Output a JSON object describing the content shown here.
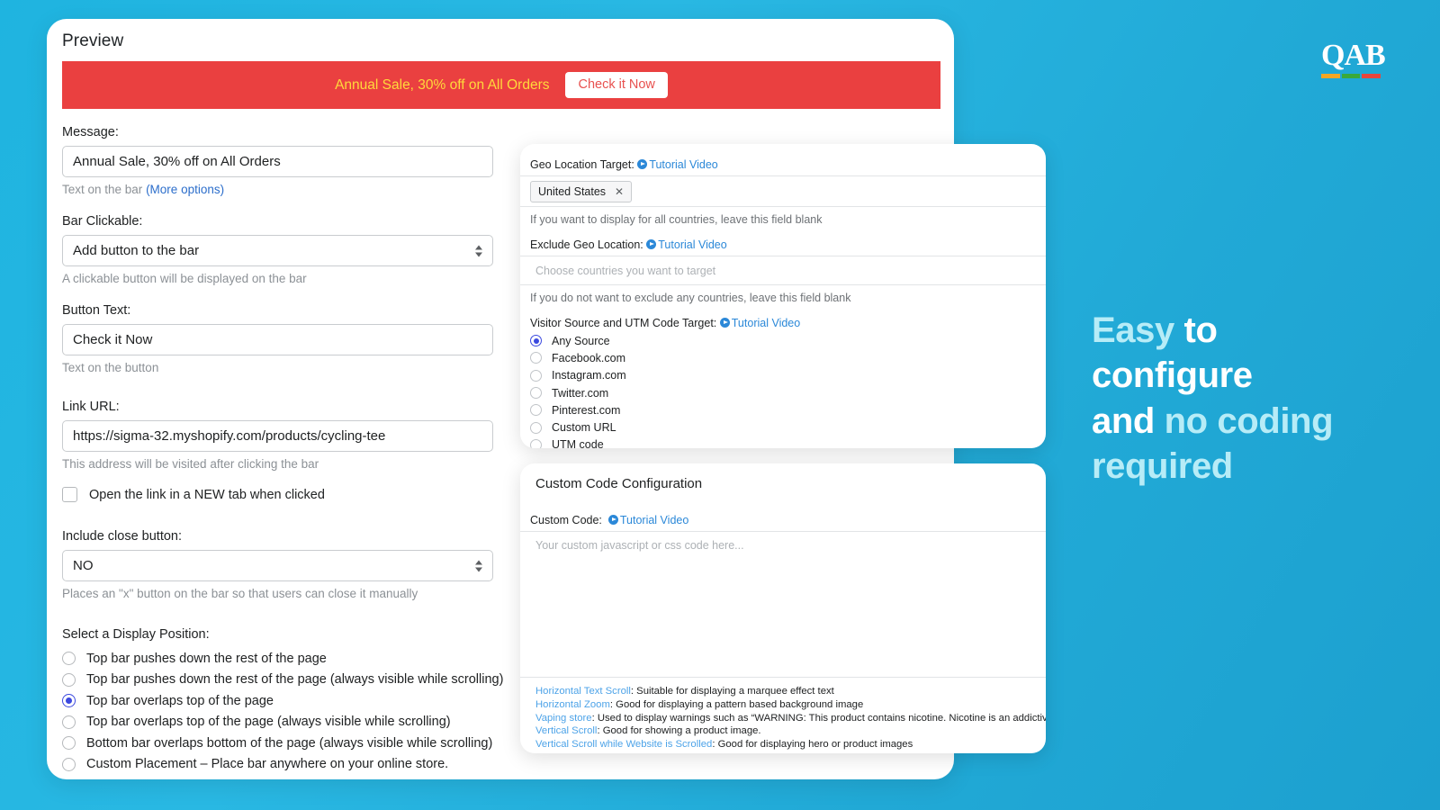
{
  "colors": {
    "background_start": "#1fb4e0",
    "background_end": "#1ca0cf",
    "bar_red": "#ea4040",
    "bar_text_yellow": "#ffd93b",
    "bar_button_text": "#e8514f",
    "accent_blue": "#3b49df",
    "link_blue": "#2c6ecb",
    "tutorial_blue": "#2b88d8",
    "headline_cyan": "#b7ecf7"
  },
  "main_card": {
    "preview_title": "Preview",
    "preview_bar": {
      "message": "Annual Sale, 30% off on All Orders",
      "button_label": "Check it Now"
    },
    "fields": {
      "message": {
        "label": "Message:",
        "value": "Annual Sale, 30% off on All Orders",
        "help_prefix": "Text on the bar ",
        "help_link": "(More options)"
      },
      "bar_clickable": {
        "label": "Bar Clickable:",
        "value": "Add button to the bar",
        "help": "A clickable button will be displayed on the bar"
      },
      "button_text": {
        "label": "Button Text:",
        "value": "Check it Now",
        "help": "Text on the button"
      },
      "link_url": {
        "label": "Link URL:",
        "value": "https://sigma-32.myshopify.com/products/cycling-tee",
        "help": "This address will be visited after clicking the bar"
      },
      "new_tab_checkbox": {
        "label": "Open the link in a NEW tab when clicked",
        "checked": false
      },
      "close_button": {
        "label": "Include close button:",
        "value": "NO",
        "help": "Places an \"x\" button on the bar so that users can close it manually"
      },
      "display_position": {
        "label": "Select a Display Position:",
        "options": [
          {
            "label": "Top bar pushes down the rest of the page",
            "selected": false
          },
          {
            "label": "Top bar pushes down the rest of the page (always visible while scrolling)",
            "selected": false
          },
          {
            "label": "Top bar overlaps top of the page",
            "selected": true
          },
          {
            "label": "Top bar overlaps top of the page (always visible while scrolling)",
            "selected": false
          },
          {
            "label": "Bottom bar overlaps bottom of the page (always visible while scrolling)",
            "selected": false
          },
          {
            "label": "Custom Placement – Place bar anywhere on your online store.",
            "selected": false
          }
        ]
      }
    }
  },
  "geo_panel": {
    "geo_target": {
      "label": "Geo Location Target:",
      "tutorial_label": "Tutorial Video",
      "token": "United States",
      "token_remove": "✕",
      "note": "If you want to display for all countries, leave this field blank"
    },
    "geo_exclude": {
      "label": "Exclude Geo Location:",
      "tutorial_label": "Tutorial Video",
      "placeholder": "Choose countries you want to target",
      "note": "If you do not want to exclude any countries, leave this field blank"
    },
    "visitor_source": {
      "label": "Visitor Source and UTM Code Target:",
      "tutorial_label": "Tutorial Video",
      "options": [
        {
          "label": "Any Source",
          "selected": true
        },
        {
          "label": "Facebook.com",
          "selected": false
        },
        {
          "label": "Instagram.com",
          "selected": false
        },
        {
          "label": "Twitter.com",
          "selected": false
        },
        {
          "label": "Pinterest.com",
          "selected": false
        },
        {
          "label": "Custom URL",
          "selected": false
        },
        {
          "label": "UTM code",
          "selected": false
        }
      ]
    }
  },
  "code_panel": {
    "title": "Custom Code Configuration",
    "custom_code": {
      "label": "Custom Code:",
      "tutorial_label": "Tutorial Video",
      "placeholder": "Your custom javascript or css code here...",
      "value": ""
    },
    "tips": [
      {
        "key": "Horizontal Text Scroll",
        "text": ": Suitable for displaying a marquee effect text"
      },
      {
        "key": "Horizontal Zoom",
        "text": ": Good for displaying a pattern based background image"
      },
      {
        "key": "Vaping store",
        "text": ": Used to display warnings such as “WARNING: This product contains nicotine. Nicotine is an addictive chemical.”"
      },
      {
        "key": "Vertical Scroll",
        "text": ": Good for showing a product image."
      },
      {
        "key": "Vertical Scroll while Website is Scrolled",
        "text": ": Good for displaying hero or product images"
      }
    ]
  },
  "marketing": {
    "headline_parts": [
      {
        "text": "Easy",
        "color": "cyan"
      },
      {
        "text": " to",
        "color": "white"
      },
      {
        "text": "configure",
        "color": "white"
      },
      {
        "text": "and ",
        "color": "white"
      },
      {
        "text": "no coding",
        "color": "cyan"
      },
      {
        "text": "required",
        "color": "cyan"
      }
    ],
    "line1_a": "Easy",
    "line1_b": " to",
    "line2": "configure",
    "line3_a": "and ",
    "line3_b": "no coding",
    "line4": "required"
  },
  "logo": {
    "text": "QAB",
    "bar_colors": [
      "#f5a623",
      "#3aa93a",
      "#e8453c"
    ]
  }
}
